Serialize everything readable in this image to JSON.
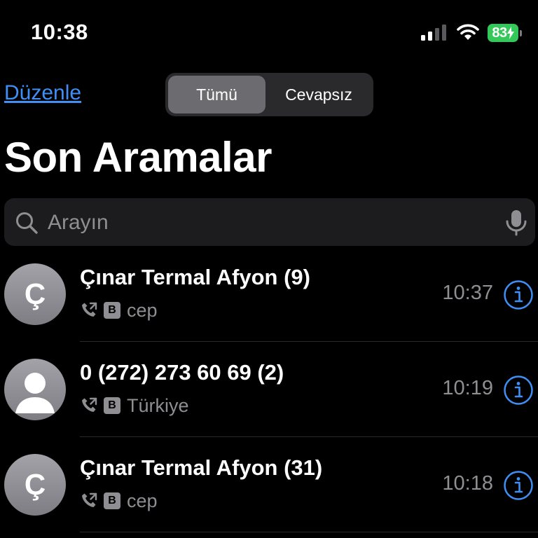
{
  "status_bar": {
    "time": "10:38",
    "battery_level": "83",
    "battery_color": "#34c759"
  },
  "header": {
    "edit_label": "Düzenle",
    "segments": [
      {
        "label": "Tümü",
        "selected": true
      },
      {
        "label": "Cevapsız",
        "selected": false
      }
    ],
    "title": "Son Aramalar"
  },
  "search": {
    "placeholder": "Arayın",
    "value": ""
  },
  "calls": [
    {
      "avatar": "Ç",
      "name": "Çınar Termal Afyon (9)",
      "sim": "B",
      "label": "cep",
      "time": "10:37"
    },
    {
      "avatar": "",
      "name": "0 (272) 273 60 69 (2)",
      "sim": "B",
      "label": "Türkiye",
      "time": "10:19"
    },
    {
      "avatar": "Ç",
      "name": "Çınar Termal Afyon (31)",
      "sim": "B",
      "label": "cep",
      "time": "10:18"
    }
  ],
  "colors": {
    "accent": "#3f8ff6",
    "secondary_text": "#8e8e93",
    "background": "#000000"
  },
  "icons": [
    "search-icon",
    "microphone-icon",
    "outgoing-call-icon",
    "info-icon",
    "wifi-icon",
    "cellular-signal-icon",
    "battery-icon",
    "charging-bolt-icon",
    "person-icon"
  ]
}
